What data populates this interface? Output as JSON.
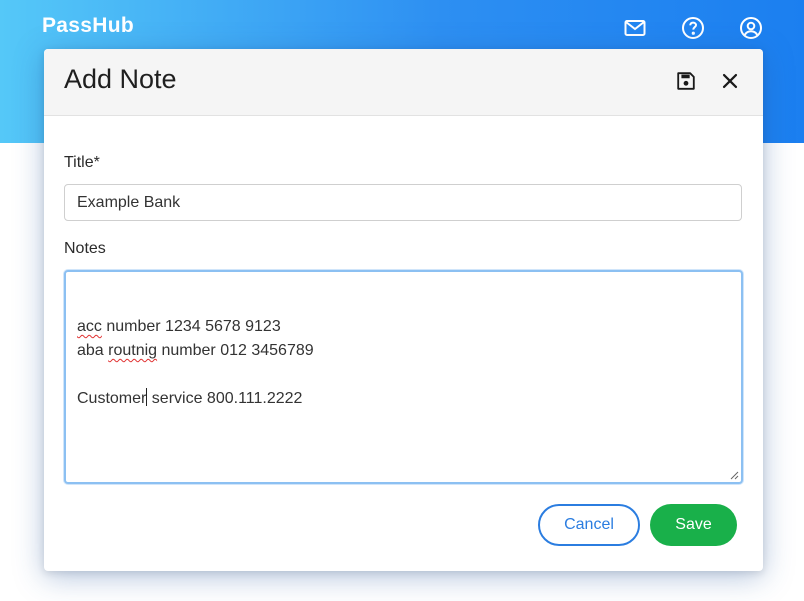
{
  "app": {
    "logo": "PassHub"
  },
  "header_icons": [
    "mail-icon",
    "help-icon",
    "account-icon"
  ],
  "modal": {
    "title": "Add Note",
    "save_icon": "floppy-disk-icon",
    "close_icon": "close-icon",
    "title_label": "Title*",
    "title_value": "Example Bank",
    "notes_label": "Notes",
    "notes_lines": [
      "",
      "acc number 1234 5678 9123",
      "aba routnig number 012 3456789",
      "",
      "Customer service 800.111.2222"
    ],
    "misspelled_words": [
      "acc",
      "routnig"
    ],
    "cancel_label": "Cancel",
    "save_label": "Save"
  },
  "colors": {
    "header_gradient_start": "#55c8f8",
    "header_gradient_end": "#1b7ff0",
    "cancel_blue": "#2b7de0",
    "save_green": "#19b04a",
    "focus_border": "#8cc0f2"
  }
}
